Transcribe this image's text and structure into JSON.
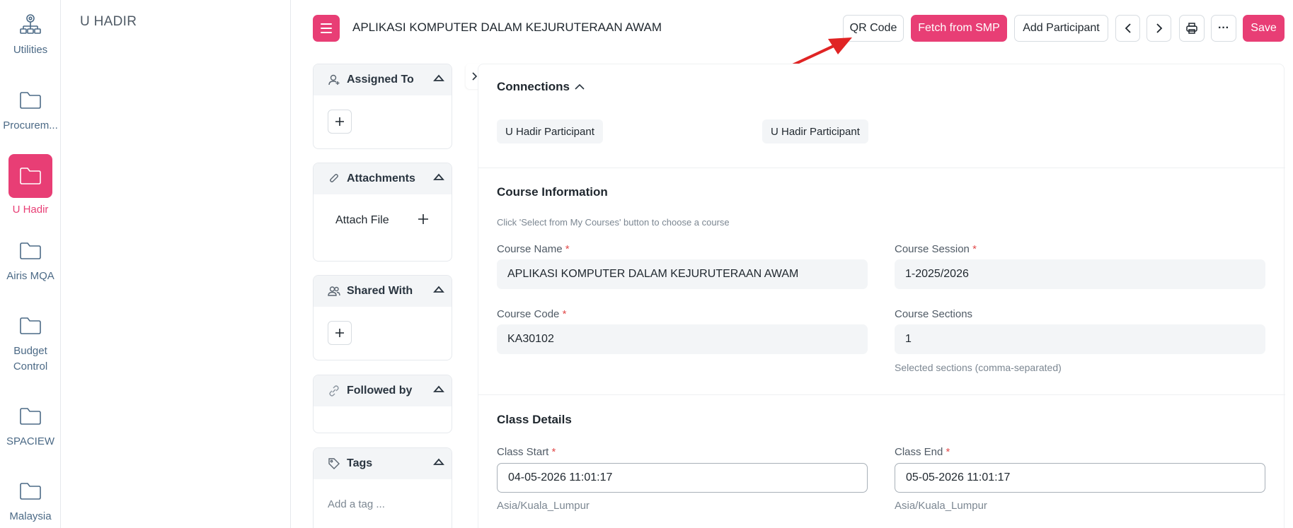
{
  "rail": {
    "items": [
      {
        "label": "Utilities",
        "icon": "sitemap-icon"
      },
      {
        "label": "Procurem...",
        "icon": "folder-icon"
      },
      {
        "label": "U Hadir",
        "icon": "folder-icon",
        "active": true
      },
      {
        "label": "Airis MQA",
        "icon": "folder-icon"
      },
      {
        "label": "Budget\nControl",
        "icon": "folder-icon"
      },
      {
        "label": "SPACIEW",
        "icon": "folder-icon"
      },
      {
        "label": "Malaysia",
        "icon": "folder-icon"
      }
    ]
  },
  "section_panel": {
    "title": "U HADIR"
  },
  "header": {
    "title": "APLIKASI KOMPUTER DALAM KEJURUTERAAN AWAM",
    "qr_label": "QR Code",
    "fetch_label": "Fetch from SMP",
    "add_participant_label": "Add Participant",
    "more_label": "···",
    "save_label": "Save"
  },
  "sidebar_cards": {
    "assigned_to": "Assigned To",
    "attachments": "Attachments",
    "attach_file": "Attach File",
    "shared_with": "Shared With",
    "followed_by": "Followed by",
    "tags": "Tags",
    "tag_placeholder": "Add a tag ..."
  },
  "connections": {
    "title": "Connections",
    "links": [
      "U Hadir Participant",
      "U Hadir Participant"
    ]
  },
  "course_info": {
    "title": "Course Information",
    "hint": "Click 'Select from My Courses' button to choose a course",
    "course_name_label": "Course Name",
    "course_name": "APLIKASI KOMPUTER DALAM KEJURUTERAAN AWAM",
    "course_session_label": "Course Session",
    "course_session": "1-2025/2026",
    "course_code_label": "Course Code",
    "course_code": "KA30102",
    "course_sections_label": "Course Sections",
    "course_sections": "1",
    "sections_hint": "Selected sections (comma-separated)"
  },
  "class_details": {
    "title": "Class Details",
    "class_start_label": "Class Start",
    "class_start": "04-05-2026 11:01:17",
    "class_end_label": "Class End",
    "class_end": "05-05-2026 11:01:17",
    "timezone": "Asia/Kuala_Lumpur"
  },
  "colors": {
    "accent": "#e83e75",
    "arrow": "#e02424"
  }
}
